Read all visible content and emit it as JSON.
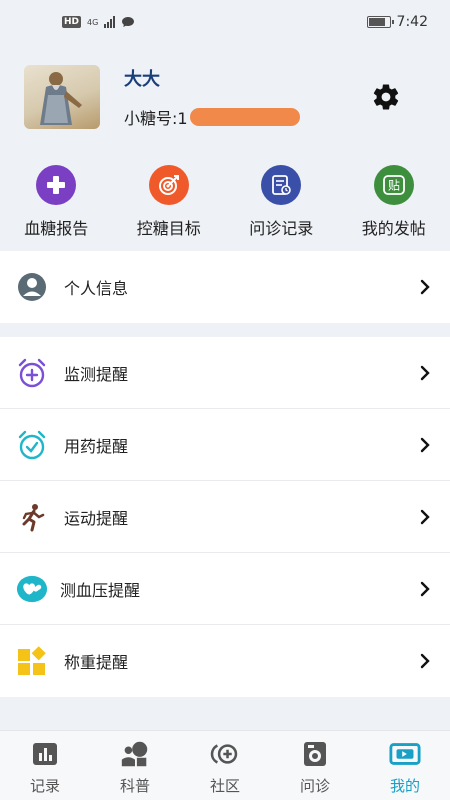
{
  "status_bar": {
    "hd": "HD",
    "network": "4G",
    "time": "7:42"
  },
  "profile": {
    "name": "大大",
    "id_label": "小糖号:1"
  },
  "quick_actions": [
    {
      "label": "血糖报告",
      "icon": "plus-circle-icon",
      "color": "#7b3fc4"
    },
    {
      "label": "控糖目标",
      "icon": "target-icon",
      "color": "#f05a2a"
    },
    {
      "label": "问诊记录",
      "icon": "record-icon",
      "color": "#3a4fa8"
    },
    {
      "label": "我的发帖",
      "icon": "post-icon",
      "color": "#3d8f3d"
    }
  ],
  "section1": [
    {
      "label": "个人信息",
      "icon": "person-icon"
    }
  ],
  "section2": [
    {
      "label": "监测提醒",
      "icon": "alarm-plus-icon",
      "color": "#7b4fd6"
    },
    {
      "label": "用药提醒",
      "icon": "alarm-check-icon",
      "color": "#1fb6c9"
    },
    {
      "label": "运动提醒",
      "icon": "running-icon",
      "color": "#6b3a2a"
    },
    {
      "label": "测血压提醒",
      "icon": "heart-pill-icon",
      "color": "#1fb6c9"
    },
    {
      "label": "称重提醒",
      "icon": "blocks-icon",
      "color": "#f5c218"
    }
  ],
  "tabs": [
    {
      "label": "记录",
      "icon": "chart-icon"
    },
    {
      "label": "科普",
      "icon": "knowledge-icon"
    },
    {
      "label": "社区",
      "icon": "community-icon"
    },
    {
      "label": "问诊",
      "icon": "consult-icon"
    },
    {
      "label": "我的",
      "icon": "mine-icon",
      "active": true
    }
  ],
  "colors": {
    "accent": "#18a0c6",
    "background": "#eef1f5"
  }
}
